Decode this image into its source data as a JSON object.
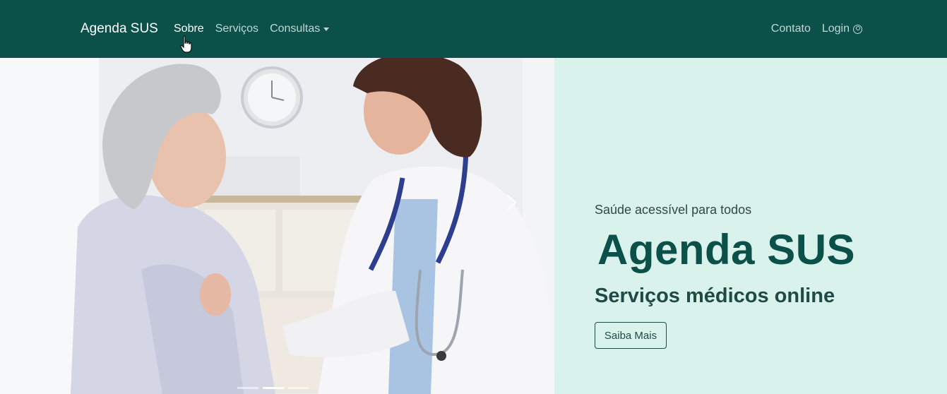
{
  "nav": {
    "brand": "Agenda SUS",
    "links": [
      {
        "label": "Sobre"
      },
      {
        "label": "Serviços"
      },
      {
        "label": "Consultas"
      }
    ],
    "right": [
      {
        "label": "Contato"
      },
      {
        "label": "Login"
      }
    ]
  },
  "hero": {
    "tagline": "Saúde acessível para todos",
    "title": "Agenda SUS",
    "subtitle": "Serviços médicos online",
    "button_label": "Saiba Mais"
  },
  "colors": {
    "navbar": "#0b5049",
    "panel": "#d9f2ec",
    "title": "#0b5049"
  },
  "icons": [
    "user-circle-icon",
    "caret-down-icon",
    "hand-cursor-icon",
    "chevron-right-icon"
  ]
}
